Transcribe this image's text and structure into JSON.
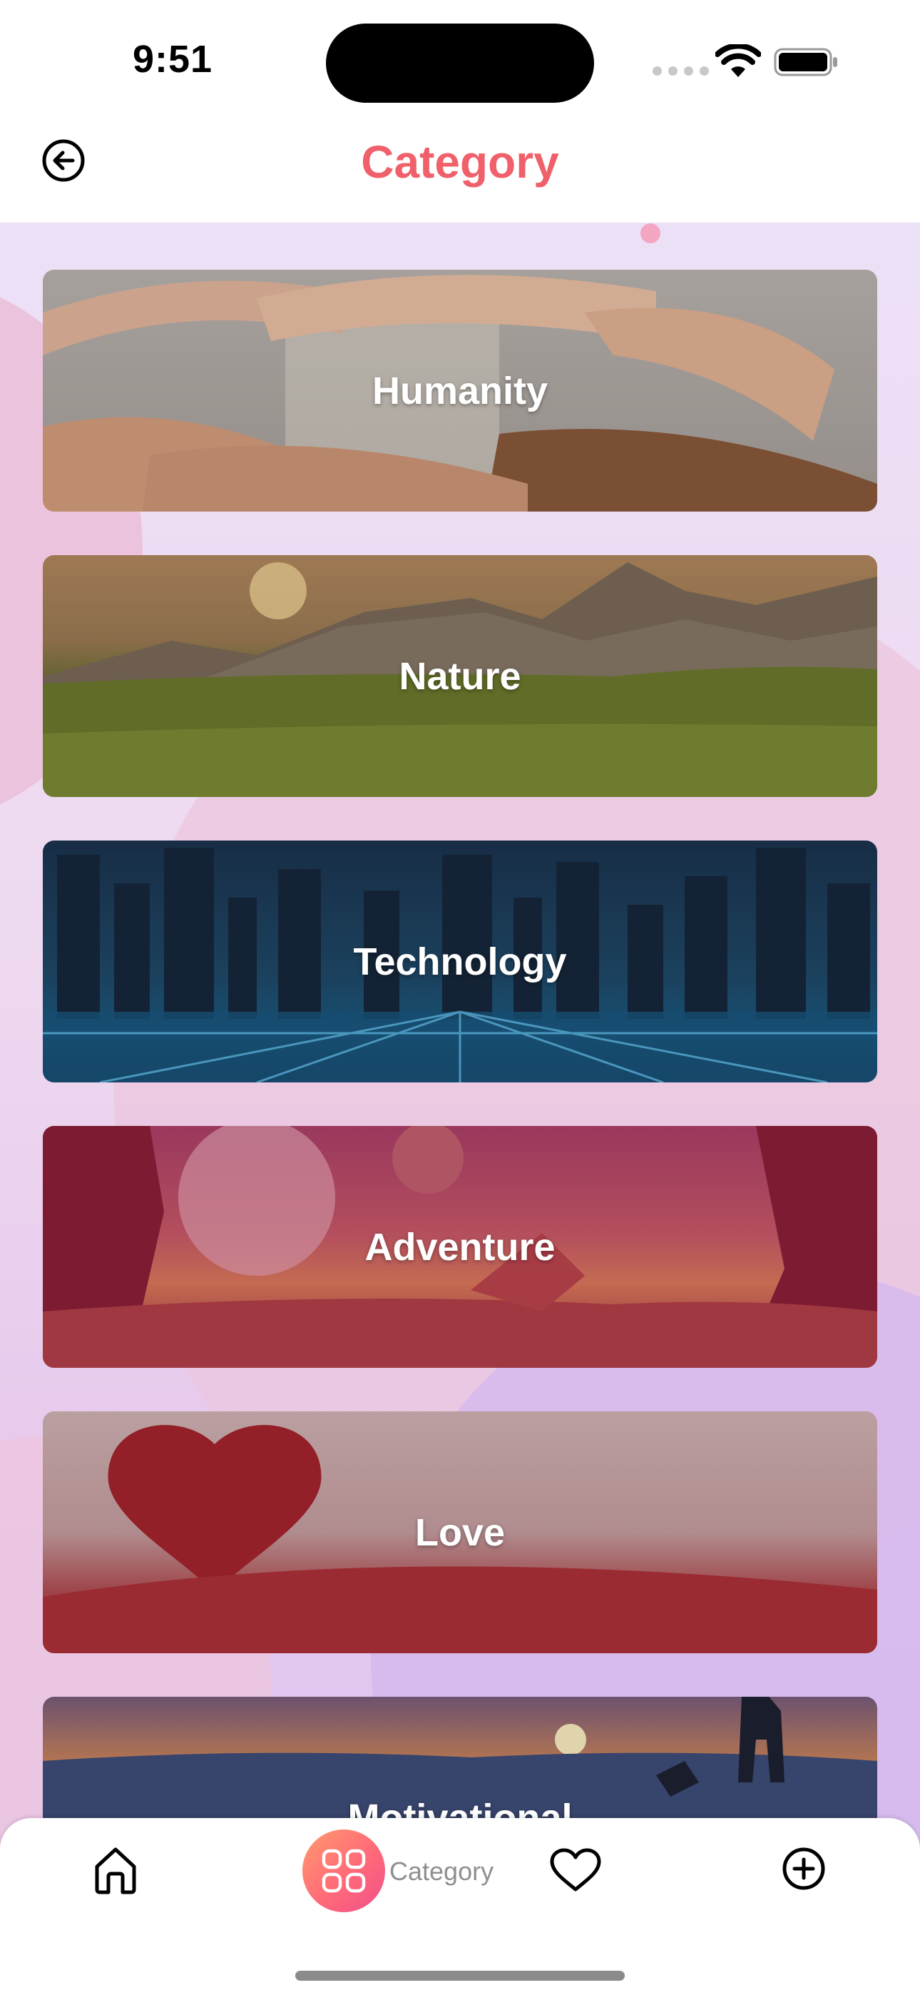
{
  "status_bar": {
    "time": "9:51"
  },
  "header": {
    "title": "Category",
    "back_icon": "back-arrow-circle-icon"
  },
  "categories": [
    {
      "label": "Humanity"
    },
    {
      "label": "Nature"
    },
    {
      "label": "Technology"
    },
    {
      "label": "Adventure"
    },
    {
      "label": "Love"
    },
    {
      "label": "Motivational"
    }
  ],
  "tabbar": {
    "home_icon": "home-icon",
    "category_icon": "grid-icon",
    "category_label": "Category",
    "favorites_icon": "heart-icon",
    "add_icon": "plus-circle-icon"
  },
  "colors": {
    "title": "#f0606a",
    "active_tab_gradient_start": "#ff9a6e",
    "active_tab_gradient_end": "#f0508a",
    "tab_label": "#8f8f8f"
  }
}
